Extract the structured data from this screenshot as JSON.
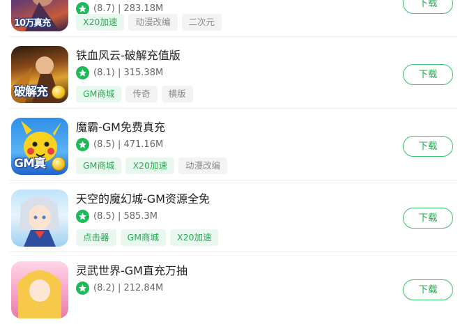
{
  "games": [
    {
      "title": "",
      "rating": "(8.7)",
      "size": "283.18M",
      "tags": [
        "X20加速",
        "动漫改编",
        "二次元"
      ],
      "tag_styles": [
        "g",
        "n",
        "n"
      ],
      "icon_text": "10万真充",
      "download": "下载"
    },
    {
      "title": "铁血风云-破解充值版",
      "rating": "(8.1)",
      "size": "315.38M",
      "tags": [
        "GM商城",
        "传奇",
        "横版"
      ],
      "tag_styles": [
        "g",
        "n",
        "n"
      ],
      "icon_text": "破解充",
      "download": "下载"
    },
    {
      "title": "魔霸-GM免费真充",
      "rating": "(8.5)",
      "size": "471.16M",
      "tags": [
        "GM商城",
        "X20加速",
        "动漫改编"
      ],
      "tag_styles": [
        "g",
        "g",
        "n"
      ],
      "icon_text": "GM真",
      "download": "下载"
    },
    {
      "title": "天空的魔幻城-GM资源全免",
      "rating": "(8.5)",
      "size": "585.3M",
      "tags": [
        "点击器",
        "GM商城",
        "X20加速"
      ],
      "tag_styles": [
        "g",
        "g",
        "g"
      ],
      "icon_text": "",
      "download": "下载"
    },
    {
      "title": "灵武世界-GM直充万抽",
      "rating": "(8.2)",
      "size": "212.84M",
      "tags": [],
      "tag_styles": [],
      "icon_text": "",
      "download": "下载"
    }
  ],
  "colors": {
    "accent": "#2aa955",
    "star": "#1fb95a",
    "tag_green_bg": "#e9f8ee",
    "tag_gray_bg": "#f3f3f3"
  },
  "icons": [
    "star-rating-icon",
    "game-app-icon"
  ]
}
